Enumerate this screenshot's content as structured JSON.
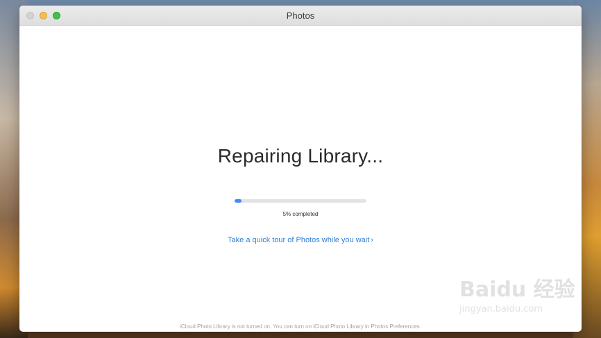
{
  "window": {
    "title": "Photos"
  },
  "status": {
    "heading": "Repairing Library...",
    "progress_percent": 5,
    "progress_label": "5% completed"
  },
  "tour": {
    "link_text": "Take a quick tour of Photos while you wait",
    "chevron": "›"
  },
  "footer": {
    "note": "iCloud Photo Library is not turned on. You can turn on iCloud Photo Library in Photos Preferences."
  },
  "watermark": {
    "brand": "Baidu 经验",
    "url": "jingyan.baidu.com"
  },
  "colors": {
    "accent": "#3f8ef1",
    "link": "#2f7fd6"
  },
  "icons": {
    "close": "close-icon",
    "minimize": "minimize-icon",
    "maximize": "maximize-icon",
    "chevron": "chevron-right-icon"
  }
}
